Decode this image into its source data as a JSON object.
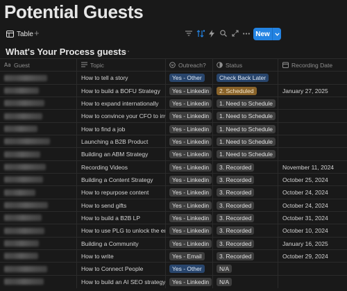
{
  "page": {
    "title": "Potential Guests"
  },
  "toolbar": {
    "view_tab_label": "Table",
    "add_view_label": "+",
    "new_button_label": "New",
    "icons": [
      "filter-icon",
      "sort-icon",
      "automation-icon",
      "search-icon",
      "expand-icon",
      "more-icon"
    ]
  },
  "database": {
    "title": "What's Your Process guests",
    "more_label": "···"
  },
  "columns": {
    "guest": "Guest",
    "topic": "Topic",
    "outreach": "Outreach?",
    "status": "Status",
    "date": "Recording Date"
  },
  "rows": [
    {
      "topic": "How to tell a story",
      "outreach": "Yes - Other",
      "outreach_color": "blue",
      "status": "Check Back Later",
      "status_color": "blue",
      "date": ""
    },
    {
      "topic": "How to build a BOFU Strategy",
      "outreach": "Yes - Linkedin",
      "outreach_color": "gray",
      "status": "2. Scheduled",
      "status_color": "orange",
      "date": "January 27, 2025"
    },
    {
      "topic": "How to expand internationally",
      "outreach": "Yes - Linkedin",
      "outreach_color": "gray",
      "status": "1. Need to Schedule",
      "status_color": "gray",
      "date": ""
    },
    {
      "topic": "How to convince your CFO to inve",
      "outreach": "Yes - Linkedin",
      "outreach_color": "gray",
      "status": "1. Need to Schedule",
      "status_color": "gray",
      "date": ""
    },
    {
      "topic": "How to find a job",
      "outreach": "Yes - Linkedin",
      "outreach_color": "gray",
      "status": "1. Need to Schedule",
      "status_color": "gray",
      "date": ""
    },
    {
      "topic": "Launching a B2B Product",
      "outreach": "Yes - Linkedin",
      "outreach_color": "gray",
      "status": "1. Need to Schedule",
      "status_color": "gray",
      "date": ""
    },
    {
      "topic": "Building an ABM Strategy",
      "outreach": "Yes - Linkedin",
      "outreach_color": "gray",
      "status": "1. Need to Schedule",
      "status_color": "gray",
      "date": ""
    },
    {
      "topic": "Recording Videos",
      "outreach": "Yes - Linkedin",
      "outreach_color": "gray",
      "status": "3. Recorded",
      "status_color": "gray",
      "date": "November 11, 2024"
    },
    {
      "topic": "Building a Content Strategy",
      "outreach": "Yes - Linkedin",
      "outreach_color": "gray",
      "status": "3. Recorded",
      "status_color": "gray",
      "date": "October 25, 2024"
    },
    {
      "topic": "How to repurpose content",
      "outreach": "Yes - Linkedin",
      "outreach_color": "gray",
      "status": "3. Recorded",
      "status_color": "gray",
      "date": "October 24, 2024"
    },
    {
      "topic": "How to send gifts",
      "outreach": "Yes - Linkedin",
      "outreach_color": "gray",
      "status": "3. Recorded",
      "status_color": "gray",
      "date": "October 24, 2024"
    },
    {
      "topic": "How to build a B2B LP",
      "outreach": "Yes - Linkedin",
      "outreach_color": "gray",
      "status": "3. Recorded",
      "status_color": "gray",
      "date": "October 31, 2024"
    },
    {
      "topic": "How to use PLG to unlock the entr",
      "outreach": "Yes - Linkedin",
      "outreach_color": "gray",
      "status": "3. Recorded",
      "status_color": "gray",
      "date": "October 10, 2024"
    },
    {
      "topic": "Building a Community",
      "outreach": "Yes - Linkedin",
      "outreach_color": "gray",
      "status": "3. Recorded",
      "status_color": "gray",
      "date": "January 16, 2025"
    },
    {
      "topic": "How to write",
      "outreach": "Yes - Email",
      "outreach_color": "gray",
      "status": "3. Recorded",
      "status_color": "gray",
      "date": "October 29, 2024"
    },
    {
      "topic": "How to Connect People",
      "outreach": "Yes - Other",
      "outreach_color": "blue",
      "status": "N/A",
      "status_color": "gray",
      "date": ""
    },
    {
      "topic": "How to build an AI SEO strategy",
      "outreach": "Yes - Linkedin",
      "outreach_color": "gray",
      "status": "N/A",
      "status_color": "gray",
      "date": ""
    }
  ]
}
